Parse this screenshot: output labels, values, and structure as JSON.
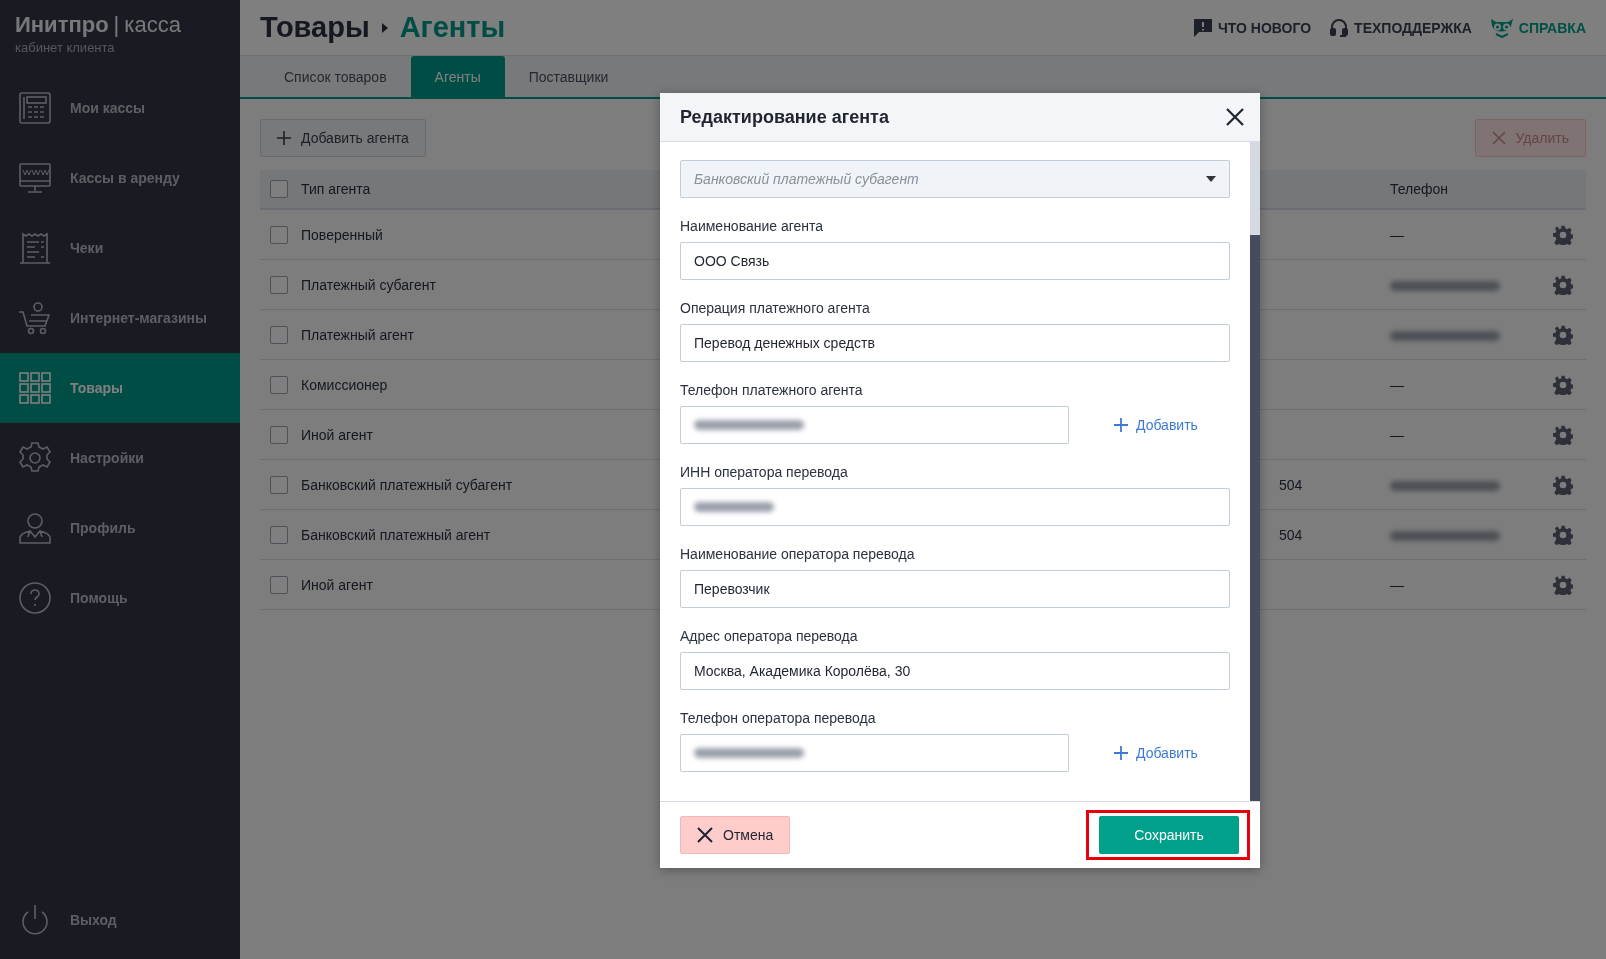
{
  "sidebar": {
    "logo": {
      "brand": "Инитпро",
      "separator": "|",
      "product": "касса",
      "subtitle": "кабинет клиента"
    },
    "items": [
      {
        "label": "Мои кассы",
        "selected": false
      },
      {
        "label": "Кассы в аренду",
        "selected": false
      },
      {
        "label": "Чеки",
        "selected": false
      },
      {
        "label": "Интернет-магазины",
        "selected": false
      },
      {
        "label": "Товары",
        "selected": true
      },
      {
        "label": "Настройки",
        "selected": false
      },
      {
        "label": "Профиль",
        "selected": false
      },
      {
        "label": "Помощь",
        "selected": false
      }
    ],
    "logout": {
      "label": "Выход"
    }
  },
  "header": {
    "breadcrumb": [
      "Товары",
      "Агенты"
    ],
    "links": [
      {
        "label": "ЧТО НОВОГО",
        "accent": false
      },
      {
        "label": "ТЕХПОДДЕРЖКА",
        "accent": false
      },
      {
        "label": "СПРАВКА",
        "accent": true
      }
    ]
  },
  "tabs": [
    {
      "label": "Список товаров",
      "selected": false
    },
    {
      "label": "Агенты",
      "selected": true
    },
    {
      "label": "Поставщики",
      "selected": false
    }
  ],
  "toolbar": {
    "add_button": "Добавить агента",
    "delete_button": {
      "label": "Удалить",
      "disabled": true
    }
  },
  "table": {
    "columns": [
      "Тип агента",
      "Телефон"
    ],
    "header_checked": false,
    "rows": [
      {
        "type": "Поверенный",
        "phone": "—",
        "phone_blurred": false,
        "checked": false
      },
      {
        "type": "Платежный субагент",
        "phone_blurred": true,
        "checked": false
      },
      {
        "type": "Платежный агент",
        "phone_blurred": true,
        "checked": false
      },
      {
        "type": "Комиссионер",
        "phone": "—",
        "phone_blurred": false,
        "checked": false
      },
      {
        "type": "Иной агент",
        "phone": "—",
        "phone_blurred": false,
        "checked": false
      },
      {
        "type": "Банковский платежный субагент",
        "column_3": "504",
        "phone_blurred": true,
        "checked": false
      },
      {
        "type": "Банковский платежный агент",
        "column_3": "504",
        "phone_blurred": true,
        "checked": false
      },
      {
        "type": "Иной агент",
        "phone": "—",
        "phone_blurred": false,
        "checked": false
      }
    ]
  },
  "dialog": {
    "title": "Редактирование агента",
    "fields": [
      {
        "kind": "select",
        "value": "Банковский платежный субагент"
      },
      {
        "kind": "text",
        "label": "Наименование агента",
        "value": "ООО Связь"
      },
      {
        "kind": "text",
        "label": "Операция платежного агента",
        "value": "Перевод денежных средств"
      },
      {
        "kind": "phone",
        "label": "Телефон платежного агента",
        "blurred": true,
        "add_label": "Добавить"
      },
      {
        "kind": "text",
        "label": "ИНН оператора перевода",
        "blurred": true
      },
      {
        "kind": "text",
        "label": "Наименование оператора перевода",
        "value": "Перевозчик"
      },
      {
        "kind": "text",
        "label": "Адрес оператора перевода",
        "value": "Москва, Академика Королёва, 30"
      },
      {
        "kind": "phone",
        "label": "Телефон оператора перевода",
        "blurred": true,
        "add_label": "Добавить"
      }
    ],
    "cancel_button": "Отмена",
    "save_button": {
      "label": "Сохранить",
      "highlighted": true
    }
  }
}
